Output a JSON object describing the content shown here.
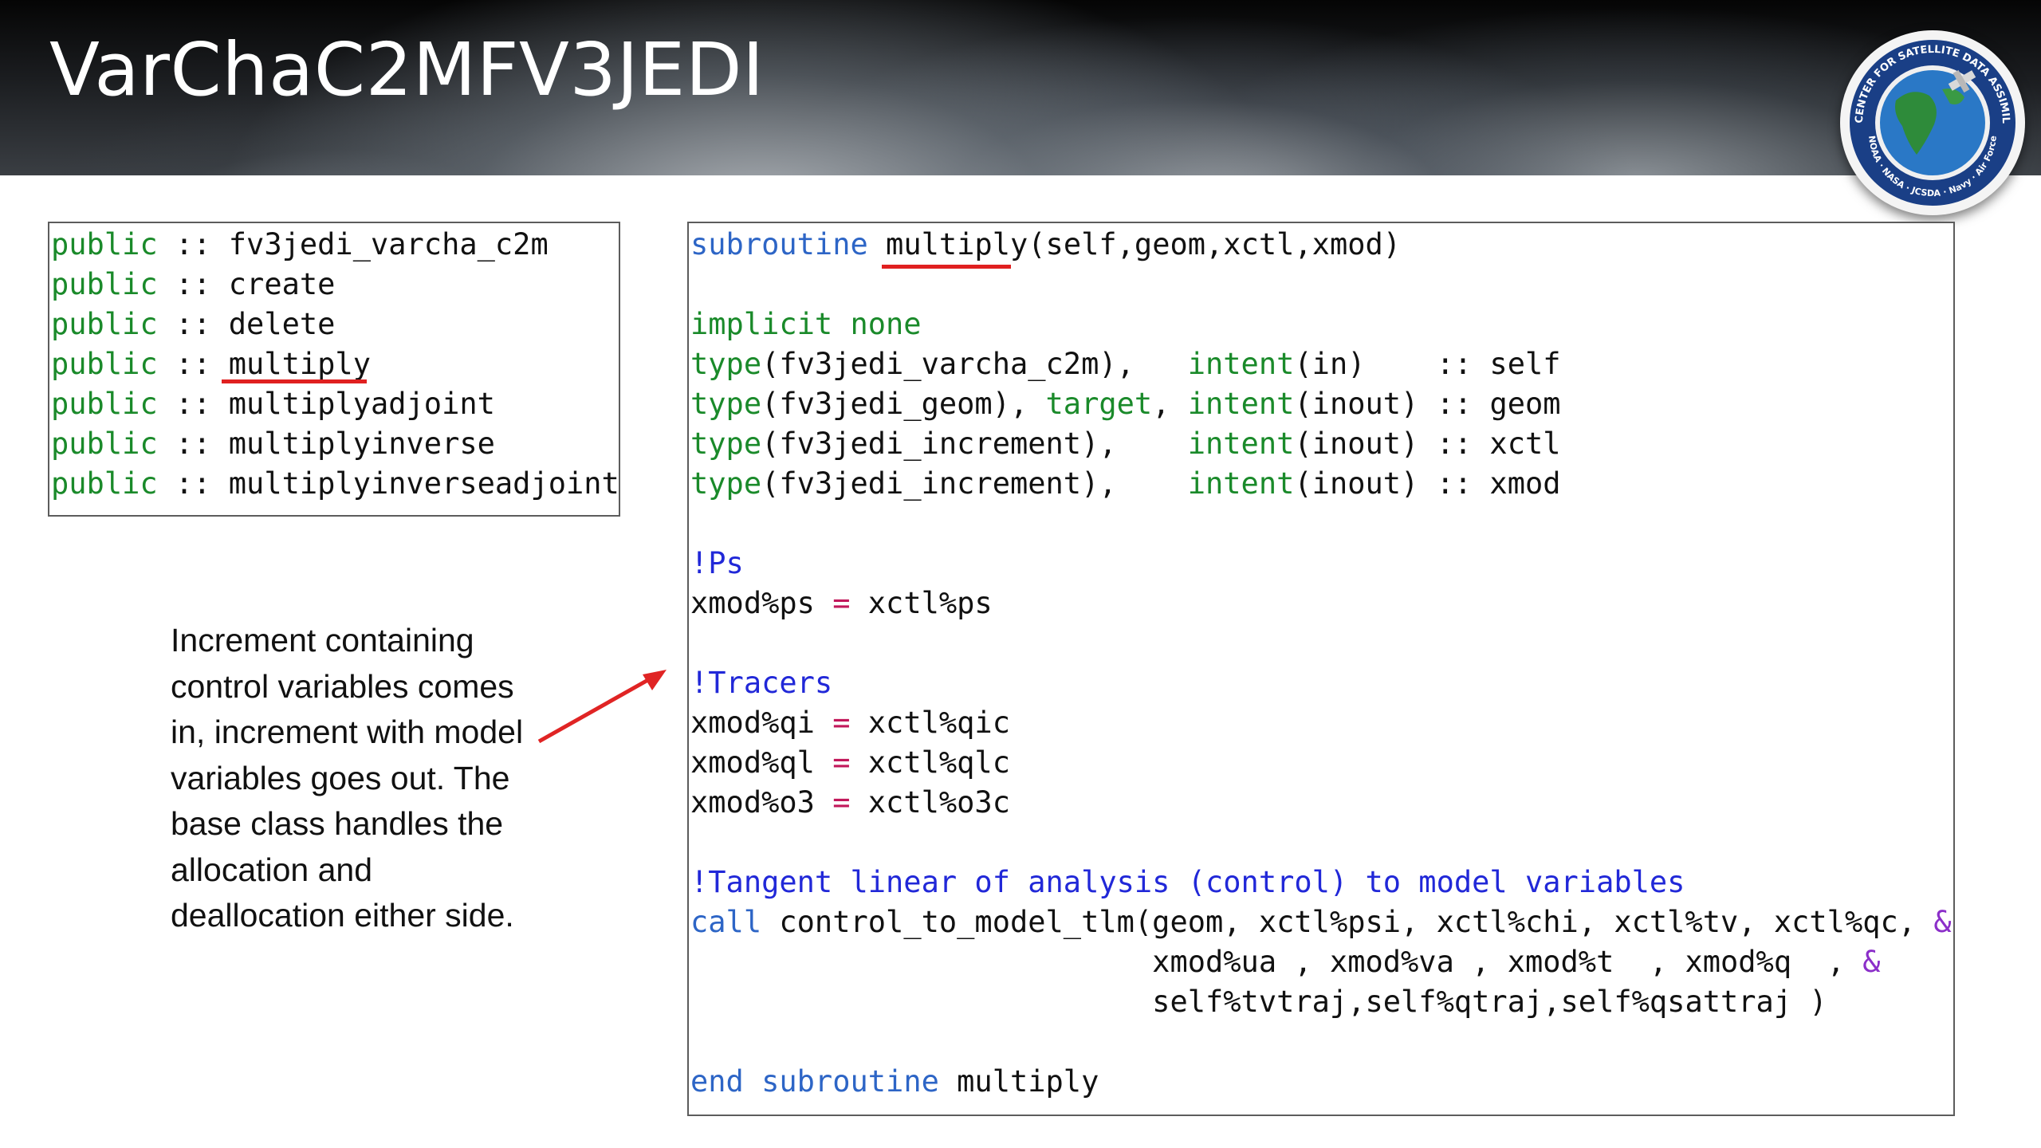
{
  "slide": {
    "title": "VarChaC2MFV3JEDI",
    "logo": {
      "ring_text": "JOINT CENTER FOR SATELLITE DATA ASSIMILATION",
      "bottom_text": "NOAA · NASA · JCSDA · Navy · Air Force"
    },
    "description": "Increment containing control variables comes in, increment with model variables goes out. The base class handles the allocation and deallocation either side."
  },
  "public_list": {
    "keyword": "public",
    "separator": " :: ",
    "items": [
      "fv3jedi_varcha_c2m",
      "create",
      "delete",
      "multiply",
      "multiplyadjoint",
      "multiplyinverse",
      "multiplyinverseadjoint"
    ]
  },
  "code": {
    "l0": {
      "kw": "subroutine",
      "a": " ",
      "u": "multiply",
      "b": "(self,geom,xctl,xmod)"
    },
    "l2": {
      "kw": "implicit none"
    },
    "l3": {
      "t": "type",
      "a": "(fv3jedi_varcha_c2m),   ",
      "i": "intent",
      "b": "(in)    :: self"
    },
    "l4": {
      "t": "type",
      "a": "(fv3jedi_geom), ",
      "tg": "target",
      "c": ", ",
      "i": "intent",
      "b": "(inout) :: geom"
    },
    "l5": {
      "t": "type",
      "a": "(fv3jedi_increment),    ",
      "i": "intent",
      "b": "(inout) :: xctl"
    },
    "l6": {
      "t": "type",
      "a": "(fv3jedi_increment),    ",
      "i": "intent",
      "b": "(inout) :: xmod"
    },
    "l8": {
      "cm": "!Ps"
    },
    "l9": {
      "lhs": "xmod%ps ",
      "eq": "=",
      "rhs": " xctl%ps"
    },
    "l11": {
      "cm": "!Tracers"
    },
    "l12": {
      "lhs": "xmod%qi ",
      "eq": "=",
      "rhs": " xctl%qic"
    },
    "l13": {
      "lhs": "xmod%ql ",
      "eq": "=",
      "rhs": " xctl%qlc"
    },
    "l14": {
      "lhs": "xmod%o3 ",
      "eq": "=",
      "rhs": " xctl%o3c"
    },
    "l16": {
      "cm": "!Tangent linear of analysis (control) to model variables"
    },
    "l17": {
      "kw": "call",
      "b": " control_to_model_tlm(geom, xctl%psi, xctl%chi, xctl%tv, xctl%qc, ",
      "amp": "&"
    },
    "l18": {
      "b": "                          xmod%ua , xmod%va , xmod%t  , xmod%q  , ",
      "amp": "&"
    },
    "l19": {
      "b": "                          self%tvtraj,self%qtraj,self%qsattraj )"
    },
    "l21": {
      "kw1": "end",
      "kw2": "subroutine",
      "b": " multiply"
    }
  }
}
